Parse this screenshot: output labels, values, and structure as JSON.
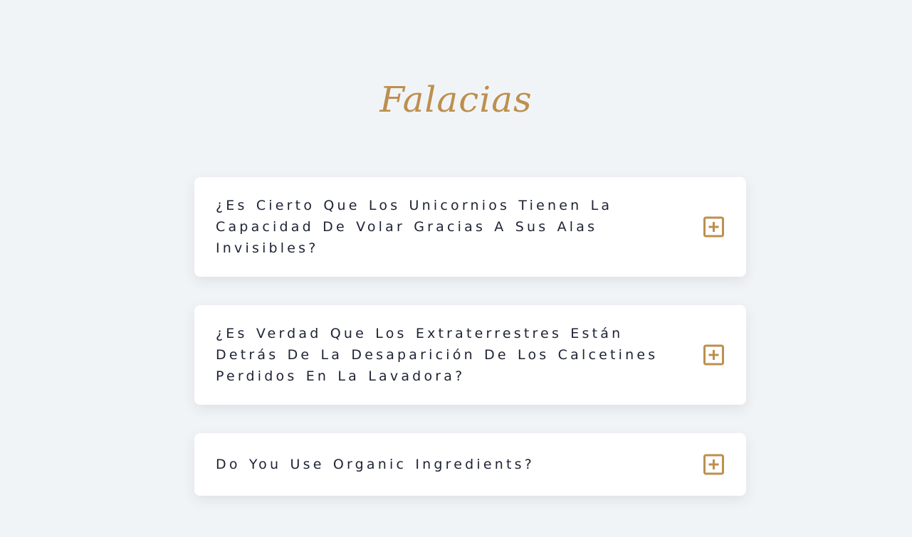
{
  "page": {
    "title": "Falacias"
  },
  "colors": {
    "background": "#f1f4f7",
    "accent": "#bd8f4e",
    "card": "#ffffff",
    "text": "#1d2233"
  },
  "faq": {
    "items": [
      {
        "question": "¿Es Cierto Que Los Unicornios Tienen La Capacidad De Volar Gracias A Sus Alas Invisibles?",
        "icon": "plus-square-icon",
        "expanded": false
      },
      {
        "question": "¿Es Verdad Que Los Extraterrestres Están Detrás De La Desaparición De Los Calcetines Perdidos En La Lavadora?",
        "icon": "plus-square-icon",
        "expanded": false
      },
      {
        "question": "Do You Use Organic Ingredients?",
        "icon": "plus-square-icon",
        "expanded": false
      }
    ]
  }
}
